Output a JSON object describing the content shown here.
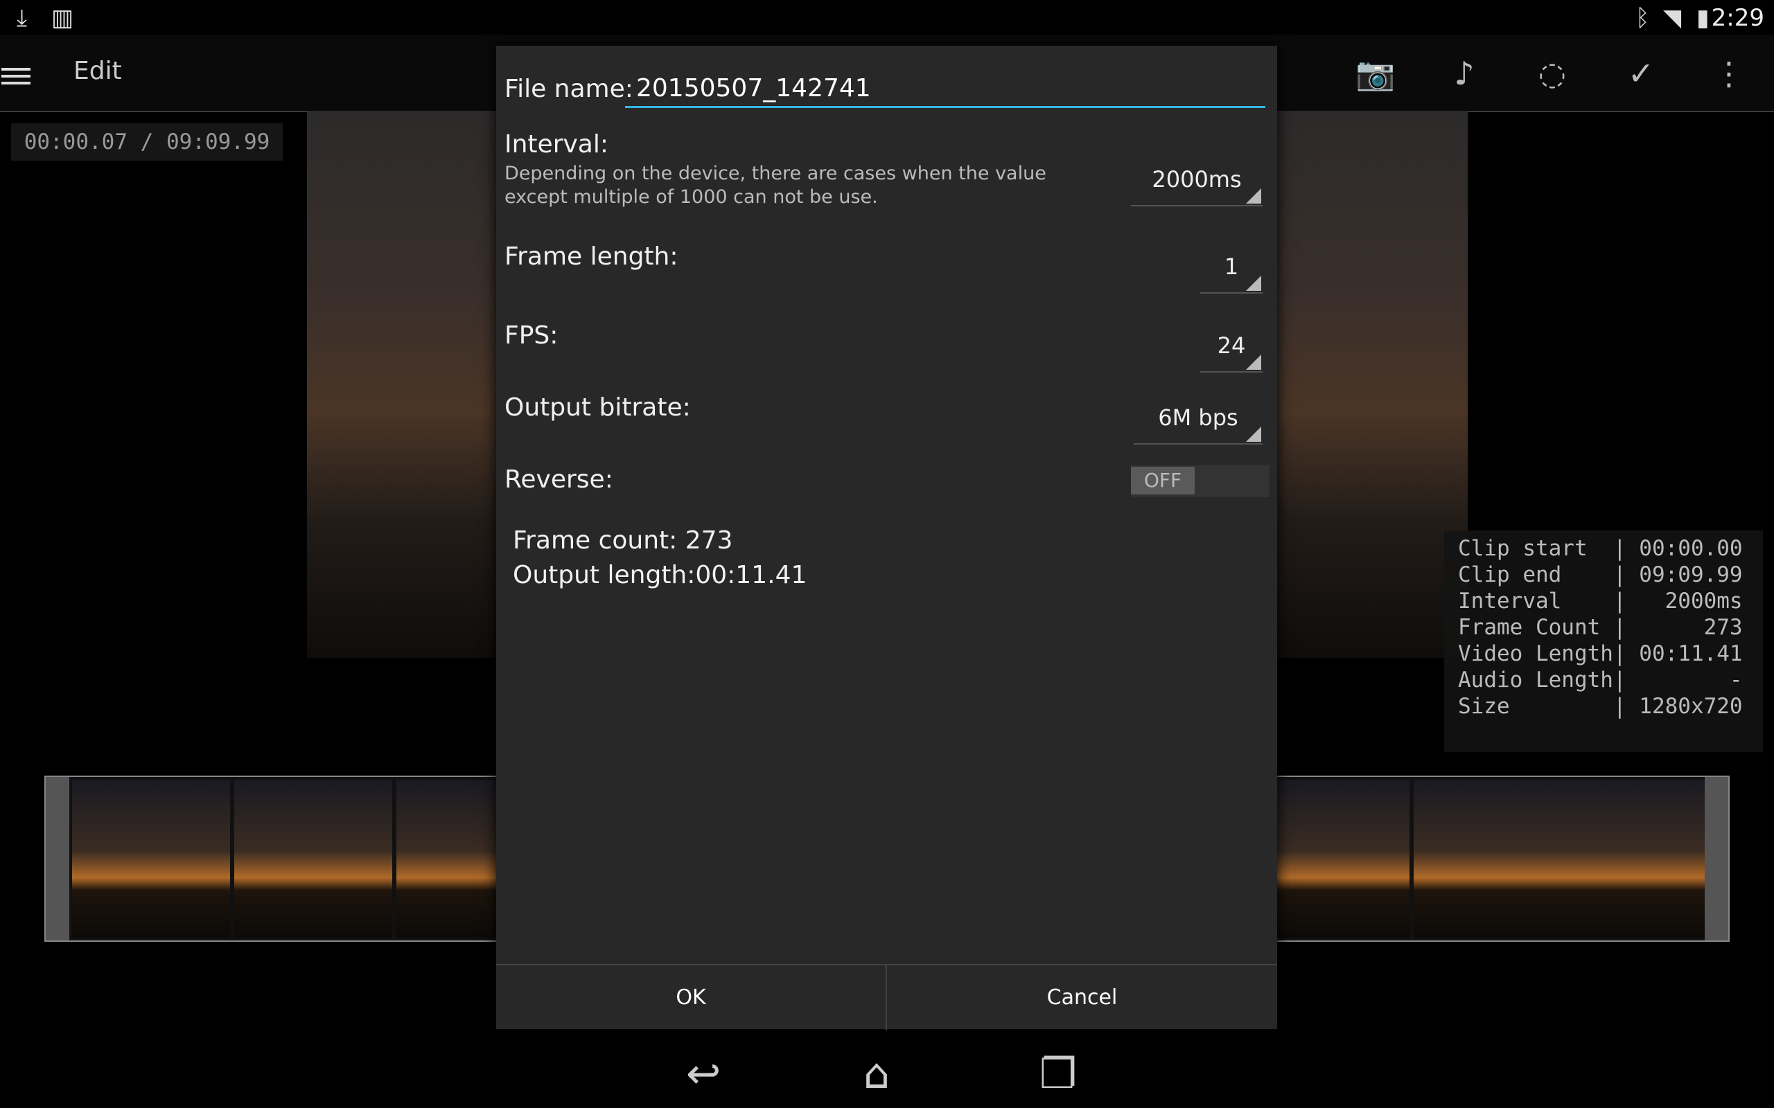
{
  "status": {
    "time": "2:29"
  },
  "actionbar": {
    "title": "Edit"
  },
  "preview": {
    "time_label": "00:00.07 / 09:09.99"
  },
  "info_panel": {
    "rows": [
      "Clip start  | 00:00.00",
      "Clip end    | 09:09.99",
      "Interval    |   2000ms",
      "Frame Count |      273",
      "Video Length| 00:11.41",
      "Audio Length|        -",
      "Size        | 1280x720"
    ]
  },
  "dialog": {
    "file_name_label": "File name:",
    "file_name_value": "20150507_142741",
    "interval_label": "Interval:",
    "interval_desc": "Depending on the device, there are cases when the value except multiple of 1000 can not be use.",
    "interval_value": "2000ms",
    "frame_length_label": "Frame length:",
    "frame_length_value": "1",
    "fps_label": "FPS:",
    "fps_value": "24",
    "bitrate_label": "Output bitrate:",
    "bitrate_value": "6M bps",
    "reverse_label": "Reverse:",
    "reverse_value": "OFF",
    "frame_count": "Frame count: 273",
    "output_length": "Output length:00:11.41",
    "ok": "OK",
    "cancel": "Cancel"
  },
  "colors": {
    "accent": "#33b5e5",
    "dialog_bg": "#282828"
  }
}
